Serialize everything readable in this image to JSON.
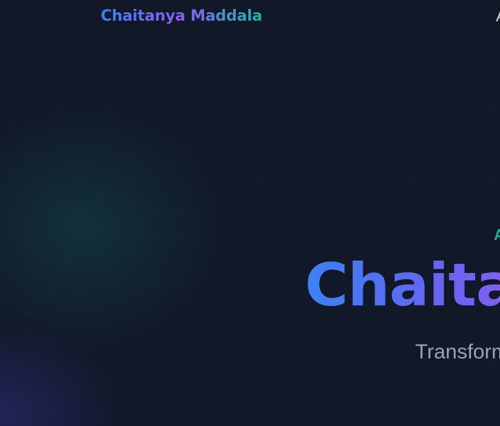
{
  "nav": {
    "brand": "Chaitanya Maddala",
    "first_item": "A"
  },
  "hero": {
    "eyebrow": "A",
    "title": "Chaita",
    "subtitle": "Transform"
  },
  "colors": {
    "background": "#111827",
    "accent_blue": "#3b82f6",
    "accent_purple": "#8b5cf6",
    "accent_teal": "#14b8a6",
    "muted_text": "#9ca3af"
  }
}
